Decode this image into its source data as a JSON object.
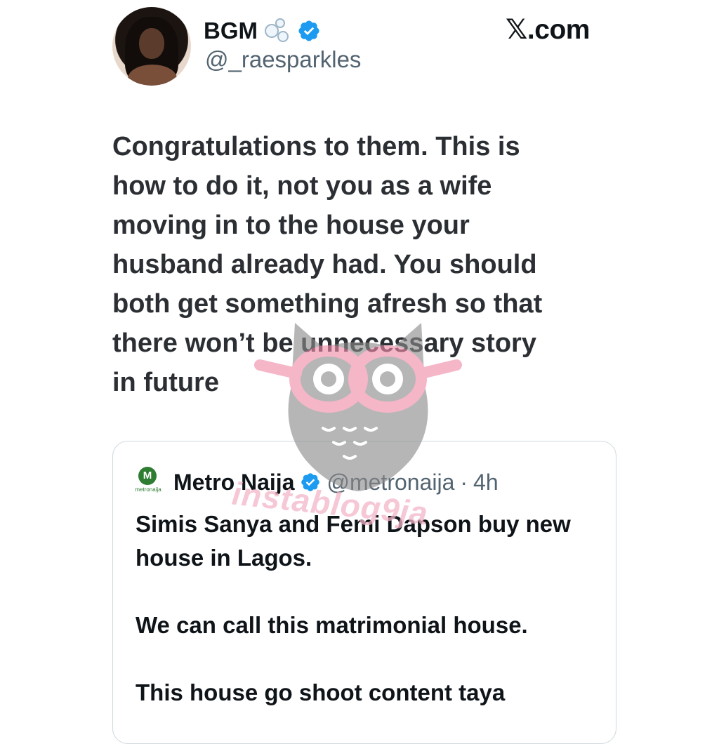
{
  "author": {
    "display_name": "BGM",
    "handle": "@_raesparkles"
  },
  "brand": {
    "label": "𝕏.com"
  },
  "tweet": {
    "text": "Congratulations to them. This is\nhow to do it, not you as a wife\nmoving in to the house your\nhusband already had. You should\nboth get something afresh so that\nthere won’t be unnecessary story\nin future"
  },
  "quoted": {
    "name": "Metro Naija",
    "handle": "@metronaija",
    "separator": "·",
    "time": "4h",
    "logo_letter": "M",
    "logo_text": "metronaija",
    "paragraphs": [
      "Simis Sanya and Femi Dapson buy new house in Lagos.",
      "We can call this matrimonial house.",
      "This house go shoot content taya"
    ]
  },
  "watermark": {
    "text": "instablog9ja"
  },
  "colors": {
    "verified": "#1d9bf0",
    "text": "#0f1419",
    "secondary": "#536471",
    "border": "#cfd9de",
    "watermark_pink": "#f08aa8",
    "watermark_gray": "#8a8a8a"
  },
  "icons": {
    "verified": "verified-badge-icon",
    "bubbles": "bubbles-icon"
  }
}
